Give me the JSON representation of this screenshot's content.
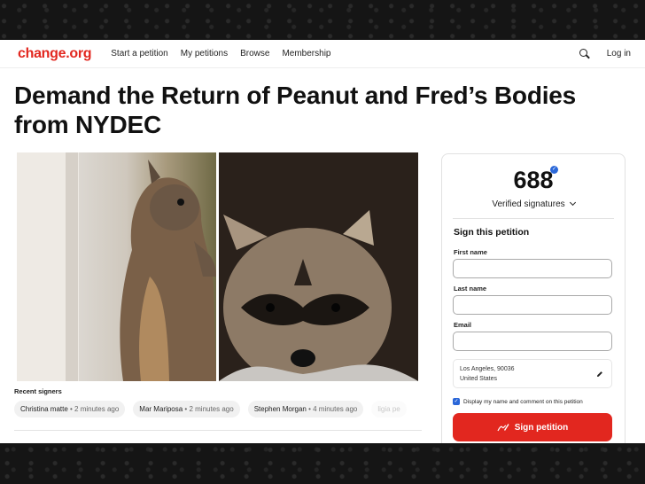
{
  "nav": {
    "logo": "change.org",
    "links": [
      "Start a petition",
      "My petitions",
      "Browse",
      "Membership"
    ],
    "search_icon": "search-icon",
    "login": "Log in"
  },
  "petition": {
    "title": "Demand the Return of Peanut and Fred’s Bodies from NYDEC"
  },
  "recent": {
    "label": "Recent signers",
    "signers": [
      {
        "name": "Christina matte",
        "meta": " • 2 minutes ago"
      },
      {
        "name": "Mar Mariposa",
        "meta": " • 2 minutes ago"
      },
      {
        "name": "Stephen Morgan",
        "meta": " • 4 minutes ago"
      },
      {
        "name": "ligia pe",
        "meta": ""
      }
    ]
  },
  "panel": {
    "count": "688",
    "verified_label": "Verified signatures",
    "sign_title": "Sign this petition",
    "first_name_label": "First name",
    "last_name_label": "Last name",
    "email_label": "Email",
    "location_line1": "Los Angeles, 90036",
    "location_line2": "United States",
    "display_text": "Display my name and comment on this petition",
    "sign_button": "Sign petition"
  },
  "colors": {
    "brand": "#e2271f",
    "check": "#2a66d8"
  }
}
